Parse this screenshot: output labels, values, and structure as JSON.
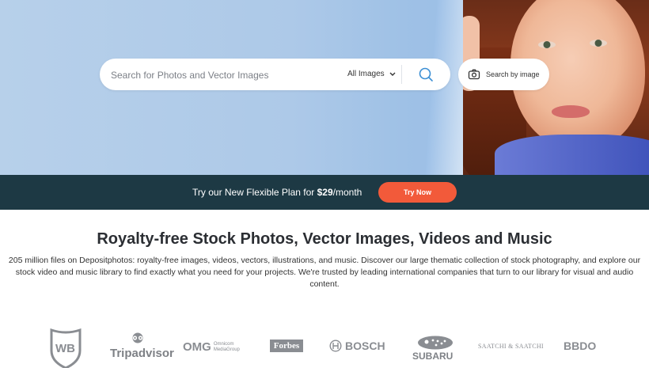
{
  "search": {
    "placeholder": "Search for Photos and Vector Images",
    "type_selected": "All Images",
    "by_image_label": "Search by image"
  },
  "promo": {
    "text_prefix": "Try our New Flexible Plan for ",
    "price": "$29",
    "text_suffix": "/month",
    "button_label": "Try Now"
  },
  "content": {
    "title": "Royalty-free Stock Photos, Vector Images, Videos and Music",
    "description": "205 million files on Depositphotos: royalty-free images, videos, vectors, illustrations, and music. Discover our large thematic collection of stock photography, and explore our stock video and music library to find exactly what you need for your projects. We're trusted by leading international companies that turn to our library for visual and audio content."
  },
  "logos": {
    "tripadvisor": "Tripadvisor",
    "omg_big": "OMG",
    "omg_small_1": "Omnicom",
    "omg_small_2": "MediaGroup",
    "forbes": "Forbes",
    "bosch": "BOSCH",
    "subaru": "SUBARU",
    "saatchi": "SAATCHI & SAATCHI",
    "bbdo": "BBDO"
  },
  "colors": {
    "promo_bg": "#1d3944",
    "accent": "#f25a3a",
    "search_icon": "#3b8fd4"
  },
  "icons": [
    "chevron-down-icon",
    "search-icon",
    "camera-icon"
  ]
}
